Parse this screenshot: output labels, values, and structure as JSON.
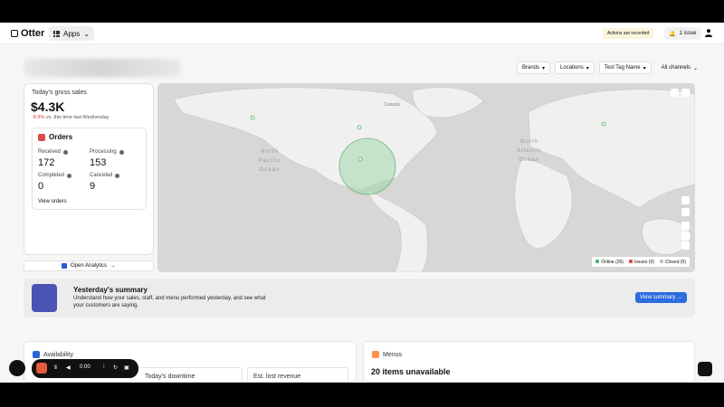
{
  "topbar": {
    "logo_text": "Otter",
    "apps_label": "Apps",
    "recording_badge": "Actions are recorded",
    "issue_label": "1 issue"
  },
  "filters": [
    "Brands",
    "Locations",
    "Test Tag Name",
    "All channels"
  ],
  "sales": {
    "label": "Today's gross sales",
    "value": "$4.3K",
    "change_pct": "-8.9%",
    "change_text": "vs. this time last Wednesday"
  },
  "orders": {
    "title": "Orders",
    "received_label": "Received",
    "received_value": "172",
    "processing_label": "Processing",
    "processing_value": "153",
    "completed_label": "Completed",
    "completed_value": "0",
    "canceled_label": "Canceled",
    "canceled_value": "9",
    "view_link": "View orders"
  },
  "open_analytics": "Open Analytics",
  "map": {
    "labels": [
      "North",
      "Pacific",
      "Ocean",
      "North",
      "Atlantic",
      "Ocean",
      "Canada"
    ],
    "legend": {
      "online": "Online (26)",
      "issues": "Issues (0)",
      "closed": "Closed (0)"
    },
    "legend_colors": {
      "online": "#55b26c",
      "issues": "#d94a4a",
      "closed": "#c2c2c2"
    }
  },
  "summary": {
    "title": "Yesterday's summary",
    "description": "Understand how your sales, staff, and menu performed yesterday, and see what your customers are saying.",
    "button": "View summary"
  },
  "availability": {
    "title": "Availability",
    "downtime_label": "Today's downtime",
    "lost_revenue_label": "Est. lost revenue"
  },
  "menus": {
    "title": "Menus",
    "unavailable": "20 items unavailable"
  },
  "recorder": {
    "time": "0:00"
  }
}
